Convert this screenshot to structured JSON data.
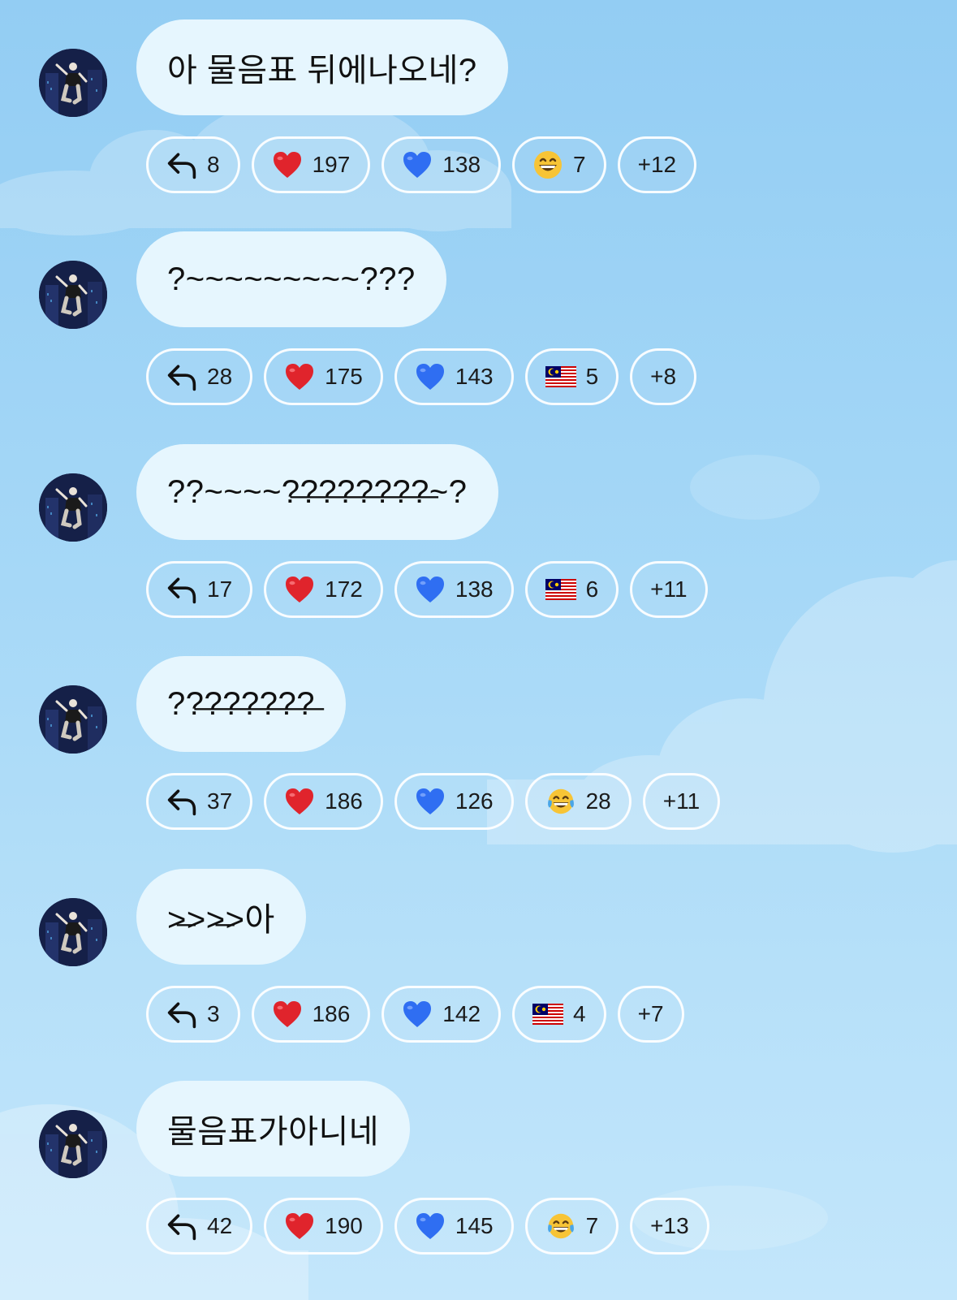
{
  "colors": {
    "bubble": "#e6f6fe",
    "chip_border": "#ffffff",
    "heart_red": "#e0242c",
    "heart_blue": "#2f6ef2",
    "background_top": "#93cdf3",
    "background_bottom": "#c3e6fb"
  },
  "messages": [
    {
      "text": "아 물음표 뒤에나오네?",
      "reactions": [
        {
          "icon": "reply-icon",
          "count": "8"
        },
        {
          "icon": "red-heart-icon",
          "count": "197"
        },
        {
          "icon": "blue-heart-icon",
          "count": "138"
        },
        {
          "icon": "grinning-face-icon",
          "count": "7"
        }
      ],
      "more": "+12"
    },
    {
      "text": "?~~~~~~~~~???",
      "reactions": [
        {
          "icon": "reply-icon",
          "count": "28"
        },
        {
          "icon": "red-heart-icon",
          "count": "175"
        },
        {
          "icon": "blue-heart-icon",
          "count": "143"
        },
        {
          "icon": "malaysia-flag-icon",
          "count": "5"
        }
      ],
      "more": "+8"
    },
    {
      "text": "??~~~~?̶?̶?̶?̶?̶?̶?̶?̶~?",
      "reactions": [
        {
          "icon": "reply-icon",
          "count": "17"
        },
        {
          "icon": "red-heart-icon",
          "count": "172"
        },
        {
          "icon": "blue-heart-icon",
          "count": "138"
        },
        {
          "icon": "malaysia-flag-icon",
          "count": "6"
        }
      ],
      "more": "+11"
    },
    {
      "text": "??̶?̶?̶?̶?̶?̶?̶",
      "reactions": [
        {
          "icon": "reply-icon",
          "count": "37"
        },
        {
          "icon": "red-heart-icon",
          "count": "186"
        },
        {
          "icon": "blue-heart-icon",
          "count": "126"
        },
        {
          "icon": "tears-of-joy-icon",
          "count": "28"
        }
      ],
      "more": "+11"
    },
    {
      "text": ">̶>>̶>아",
      "reactions": [
        {
          "icon": "reply-icon",
          "count": "3"
        },
        {
          "icon": "red-heart-icon",
          "count": "186"
        },
        {
          "icon": "blue-heart-icon",
          "count": "142"
        },
        {
          "icon": "malaysia-flag-icon",
          "count": "4"
        }
      ],
      "more": "+7"
    },
    {
      "text": "물음표가아니네",
      "reactions": [
        {
          "icon": "reply-icon",
          "count": "42"
        },
        {
          "icon": "red-heart-icon",
          "count": "190"
        },
        {
          "icon": "blue-heart-icon",
          "count": "145"
        },
        {
          "icon": "tears-of-joy-icon",
          "count": "7"
        }
      ],
      "more": "+13"
    }
  ]
}
